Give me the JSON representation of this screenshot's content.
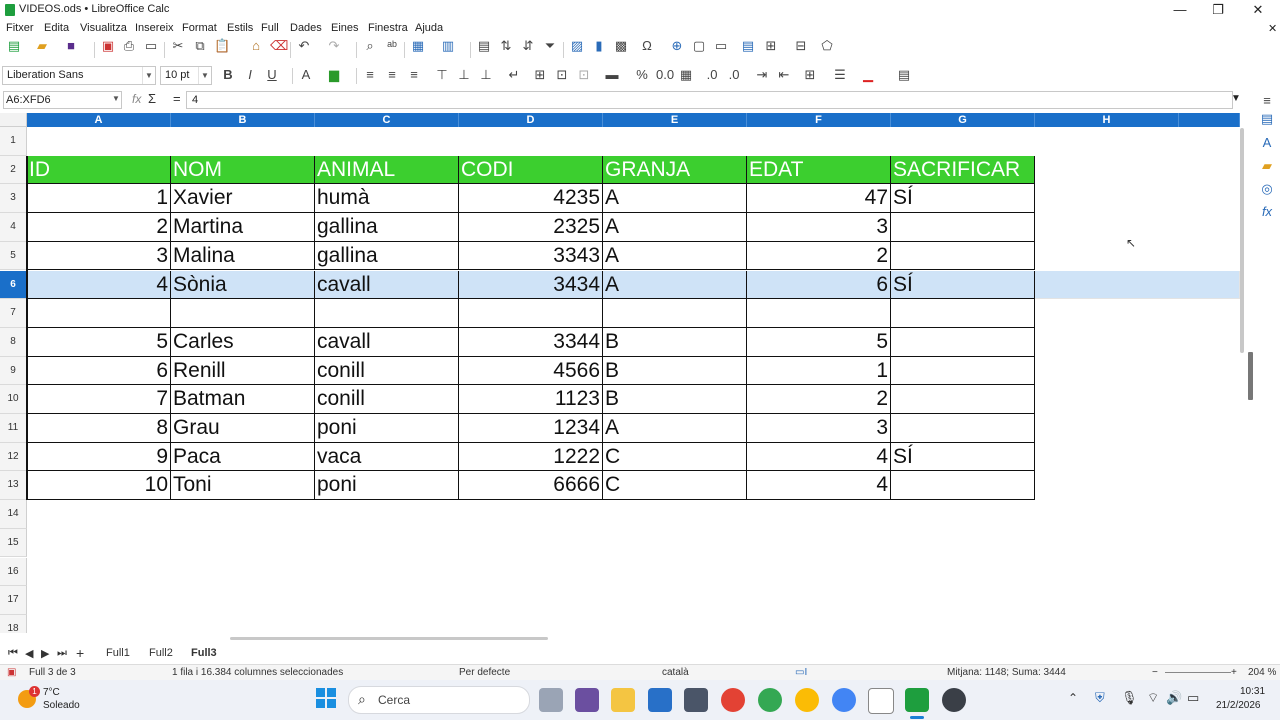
{
  "window": {
    "title": "VIDEOS.ods • LibreOffice Calc"
  },
  "menubar": [
    "Fitxer",
    "Edita",
    "Visualitza",
    "Insereix",
    "Format",
    "Estils",
    "Full",
    "Dades",
    "Eines",
    "Finestra",
    "Ajuda"
  ],
  "toolbar": {
    "font_name": "Liberation Sans",
    "font_size": "10 pt",
    "bold": "B",
    "italic": "I",
    "underline": "U"
  },
  "formula_bar": {
    "name_box": "A6:XFD6",
    "fx": "fx",
    "sigma": "Σ",
    "equals": "=",
    "content": "4"
  },
  "grid": {
    "columns": [
      "A",
      "B",
      "C",
      "D",
      "E",
      "F",
      "G",
      "H"
    ],
    "rows": [
      "1",
      "2",
      "3",
      "4",
      "5",
      "6",
      "7",
      "8",
      "9",
      "10",
      "11",
      "12",
      "13",
      "14",
      "15",
      "16",
      "17",
      "18"
    ],
    "selected_row": "6",
    "headers": [
      "ID",
      "NOM",
      "ANIMAL",
      "CODI",
      "GRANJA",
      "EDAT",
      "SACRIFICAR"
    ],
    "data": [
      [
        "1",
        "Xavier",
        "humà",
        "4235",
        "A",
        "47",
        "SÍ"
      ],
      [
        "2",
        "Martina",
        "gallina",
        "2325",
        "A",
        "3",
        ""
      ],
      [
        "3",
        "Malina",
        "gallina",
        "3343",
        "A",
        "2",
        ""
      ],
      [
        "4",
        "Sònia",
        "cavall",
        "3434",
        "A",
        "6",
        "SÍ"
      ],
      [
        "",
        "",
        "",
        "",
        "",
        "",
        ""
      ],
      [
        "5",
        "Carles",
        "cavall",
        "3344",
        "B",
        "5",
        ""
      ],
      [
        "6",
        "Renill",
        "conill",
        "4566",
        "B",
        "1",
        ""
      ],
      [
        "7",
        "Batman",
        "conill",
        "1123",
        "B",
        "2",
        ""
      ],
      [
        "8",
        "Grau",
        "poni",
        "1234",
        "A",
        "3",
        ""
      ],
      [
        "9",
        "Paca",
        "vaca",
        "1222",
        "C",
        "4",
        "SÍ"
      ],
      [
        "10",
        "Toni",
        "poni",
        "6666",
        "C",
        "4",
        ""
      ]
    ]
  },
  "sheets": {
    "tabs": [
      "Full1",
      "Full2",
      "Full3"
    ],
    "active": "Full3",
    "add": "+"
  },
  "statusbar": {
    "sheet": "Full 3 de 3",
    "selection": "1 fila i 16.384 columnes seleccionades",
    "style": "Per defecte",
    "language": "català",
    "sum": "Mitjana: 1148; Suma: 3444",
    "zoom": "204 %"
  },
  "taskbar": {
    "weather_temp": "7°C",
    "weather_desc": "Soleado",
    "weather_badge": "1",
    "search_placeholder": "Cerca",
    "time": "10:31",
    "date": "21/2/2026"
  }
}
